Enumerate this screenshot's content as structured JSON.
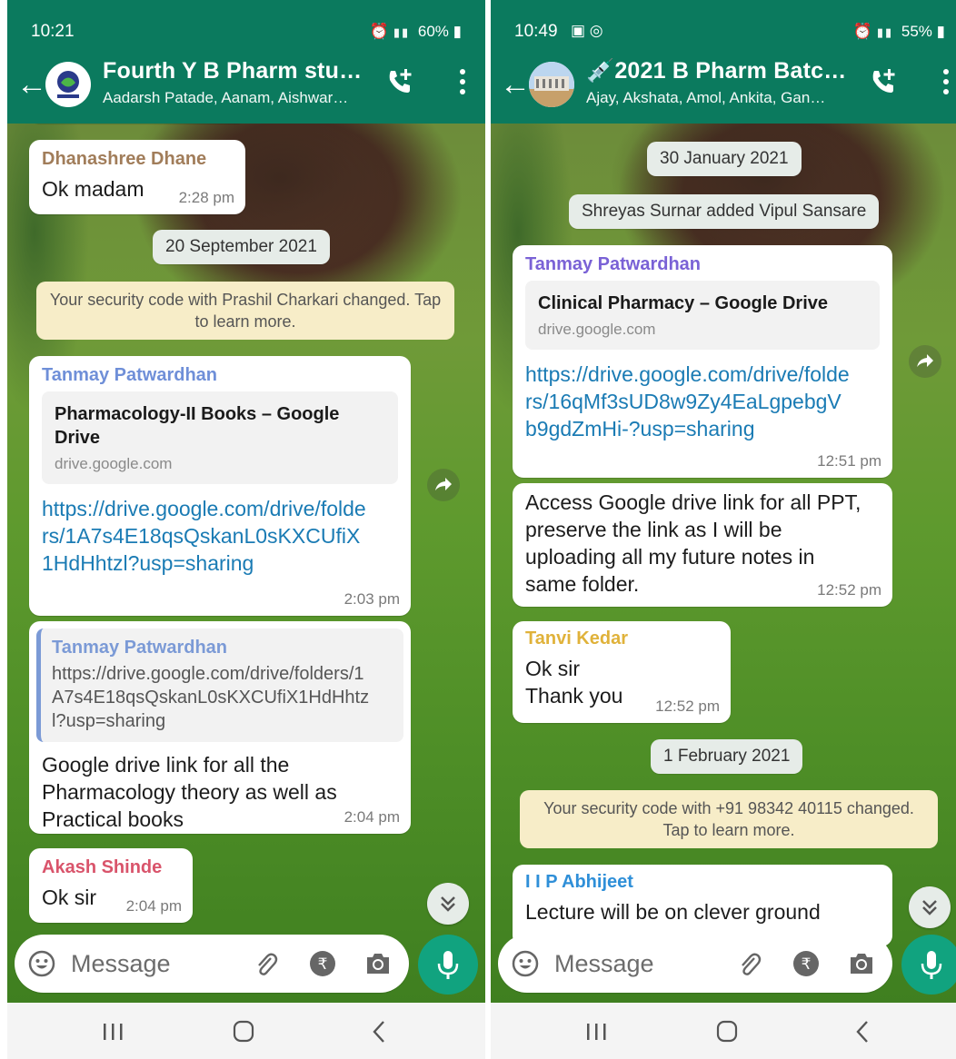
{
  "left": {
    "status": {
      "time": "10:21",
      "battery": "60%"
    },
    "header": {
      "title": "Fourth Y B Pharm stud…",
      "subtitle": "Aadarsh Patade, Aanam, Aishwar…"
    },
    "messages": {
      "m1": {
        "sender": "Dhanashree Dhane",
        "text": "Ok madam",
        "time": "2:28 pm"
      },
      "date1": "20 September 2021",
      "system1": "Your security code with Prashil Charkari changed. Tap to learn more.",
      "m2": {
        "sender": "Tanmay Patwardhan",
        "preview_title": "Pharmacology-II Books – Google Drive",
        "preview_domain": "drive.google.com",
        "link": "https://drive.google.com/drive/folders/1A7s4E18qsQskanL0sKXCUfiX1HdHhtzl?usp=sharing",
        "time": "2:03 pm"
      },
      "m3": {
        "quote_sender": "Tanmay Patwardhan",
        "quote_text": "https://drive.google.com/drive/folders/1A7s4E18qsQskanL0sKXCUfiX1HdHhtzl?usp=sharing",
        "text": "Google drive link for all the Pharmacology theory as well as Practical books",
        "time": "2:04 pm"
      },
      "m4": {
        "sender": "Akash Shinde",
        "text": "Ok sir",
        "time": "2:04 pm"
      }
    },
    "input": {
      "placeholder": "Message"
    }
  },
  "right": {
    "status": {
      "time": "10:49",
      "battery": "55%"
    },
    "header": {
      "title": "💉2021 B Pharm Batch…",
      "subtitle": "Ajay, Akshata, Amol, Ankita, Gan…"
    },
    "messages": {
      "date1": "30 January 2021",
      "system1": "Shreyas Surnar added Vipul Sansare",
      "m1": {
        "sender": "Tanmay Patwardhan",
        "preview_title": "Clinical Pharmacy – Google Drive",
        "preview_domain": "drive.google.com",
        "link": "https://drive.google.com/drive/folders/16qMf3sUD8w9Zy4EaLgpebgVb9gdZmHi-?usp=sharing",
        "time": "12:51 pm"
      },
      "m2": {
        "text": "Access Google drive link for all PPT, preserve the link as I will be uploading all my future notes in same folder.",
        "time": "12:52 pm"
      },
      "m3": {
        "sender": "Tanvi Kedar",
        "text_line1": "Ok sir",
        "text_line2": "Thank you",
        "time": "12:52 pm"
      },
      "date2": "1 February 2021",
      "system2": "Your security code with +91 98342 40115 changed. Tap to learn more.",
      "m4": {
        "sender": "I I P Abhijeet",
        "text": "Lecture will be on clever ground"
      }
    },
    "input": {
      "placeholder": "Message"
    }
  },
  "colors": {
    "header_green": "#0b7a5e",
    "link_blue": "#1a7bb4",
    "sender_dhanashree": "#a17d5a",
    "sender_tanmay_left": "#6f8fd8",
    "sender_akash": "#d9546b",
    "sender_tanmay_right": "#7a62d6",
    "sender_tanvi": "#e0b23a",
    "sender_abhijeet": "#2f8fd8",
    "mic_green": "#11a37f"
  }
}
